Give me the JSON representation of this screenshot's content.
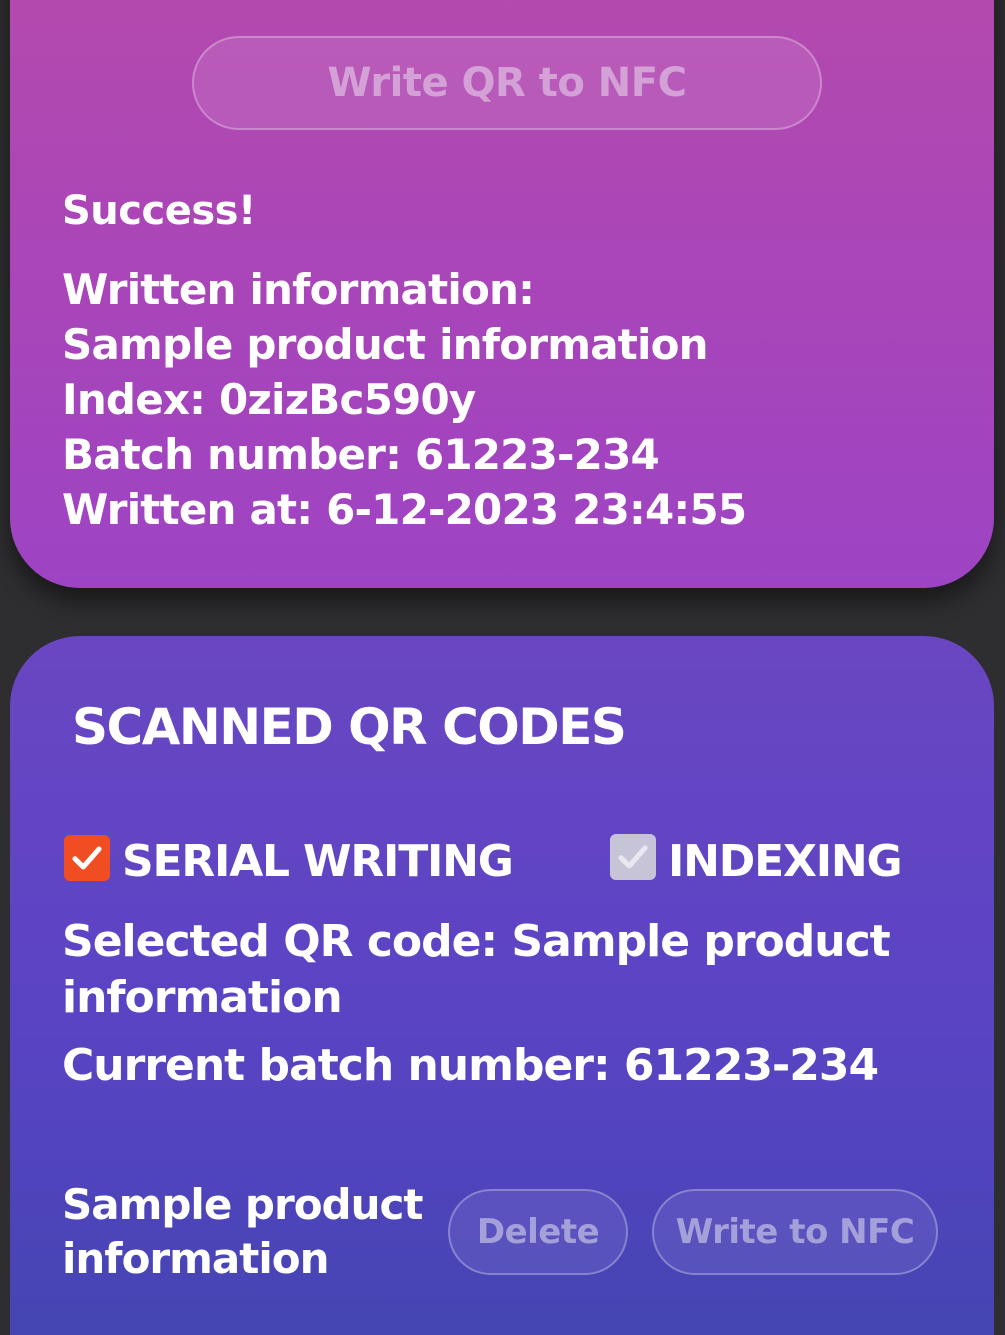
{
  "top_card": {
    "write_qr_button": "Write QR to NFC",
    "status": "Success!",
    "written_info": {
      "heading": "Written information:",
      "product": "Sample product information",
      "index": "Index: 0zizBc590y",
      "batch": "Batch number: 61223-234",
      "written_at": "Written at: 6-12-2023 23:4:55"
    }
  },
  "scanned_section": {
    "title": "SCANNED QR CODES",
    "serial_writing": {
      "label": "SERIAL WRITING",
      "checked": true,
      "color": "#f04d22"
    },
    "indexing": {
      "label": "INDEXING",
      "checked": true,
      "color": "#c8c4d8"
    },
    "selected_qr": "Selected QR code: Sample product information",
    "current_batch": "Current batch number: 61223-234",
    "items": [
      {
        "name": "Sample product information",
        "delete_label": "Delete",
        "write_label": "Write to NFC"
      }
    ]
  },
  "colors": {
    "top_card": "#a845b9",
    "bottom_card": "#5a44c4",
    "background": "#2e2e30"
  },
  "icons": [
    "check-icon"
  ]
}
